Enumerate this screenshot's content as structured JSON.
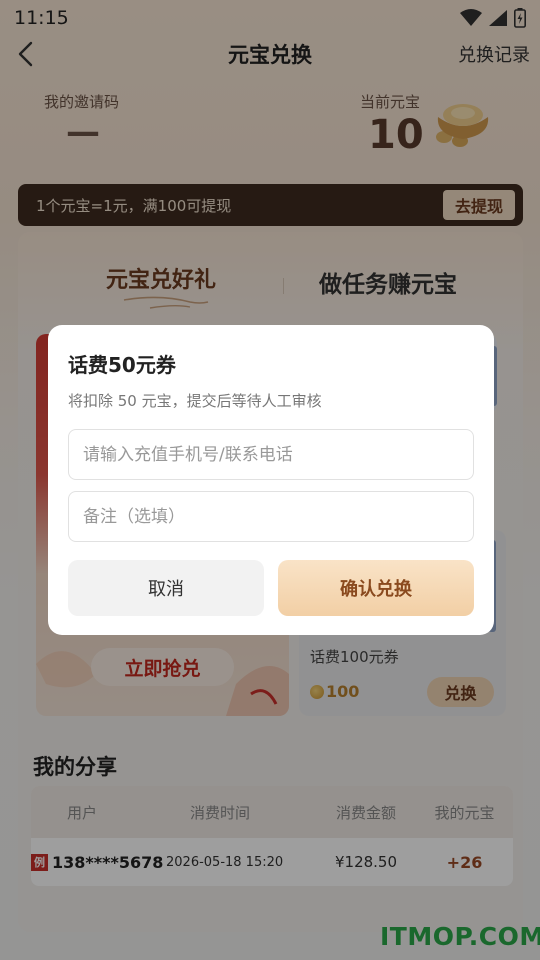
{
  "status_bar": {
    "time": "11:15"
  },
  "nav": {
    "title": "元宝兑换",
    "right_link": "兑换记录"
  },
  "header": {
    "invite_label": "我的邀请码",
    "invite_value": "—",
    "yuanbao_label": "当前元宝",
    "yuanbao_value": "10"
  },
  "rate_bar": {
    "text": "1个元宝=1元，满100可提现",
    "withdraw_label": "去提现"
  },
  "tabs": {
    "redeem": "元宝兑好礼",
    "earn": "做任务赚元宝"
  },
  "products": {
    "left_button": "立即抢兑",
    "right_name": "话费100元券",
    "right_price": "100",
    "right_button": "兑换"
  },
  "share": {
    "title": "我的分享",
    "columns": [
      "用户",
      "消费时间",
      "消费金额",
      "我的元宝"
    ],
    "rows": [
      {
        "badge": "例",
        "user": "138****5678",
        "time": "2026-05-18 15:20",
        "amount": "¥128.50",
        "yuanbao": "+26"
      }
    ]
  },
  "dialog": {
    "title": "话费50元券",
    "subtitle": "将扣除 50 元宝，提交后等待人工审核",
    "phone_placeholder": "请输入充值手机号/联系电话",
    "note_placeholder": "备注（选填）",
    "cancel_label": "取消",
    "confirm_label": "确认兑换"
  },
  "watermark": "ITMOP.COM",
  "colors": {
    "accent": "#6b3a1f",
    "price": "#b6802e",
    "overlay": "rgba(0,0,0,0.38)"
  }
}
